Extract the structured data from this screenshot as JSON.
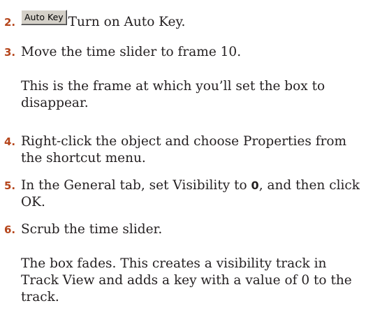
{
  "steps": [
    {
      "number": "2.",
      "button_label": "Auto Key",
      "text": "Turn on Auto Key."
    },
    {
      "number": "3.",
      "text": "Move the time slider to frame 10.",
      "note": "This is the frame at which you’ll set the box to disappear."
    },
    {
      "number": "4.",
      "text": "Right-click the object and choose Properties from the shortcut menu."
    },
    {
      "number": "5.",
      "text_before": "In the General tab, set Visibility to ",
      "bold_value": "0",
      "text_after": ", and then click OK."
    },
    {
      "number": "6.",
      "text": "Scrub the time slider.",
      "note": "The box fades. This creates a visibility track in Track View and adds a key with a value of 0 to the track."
    }
  ]
}
